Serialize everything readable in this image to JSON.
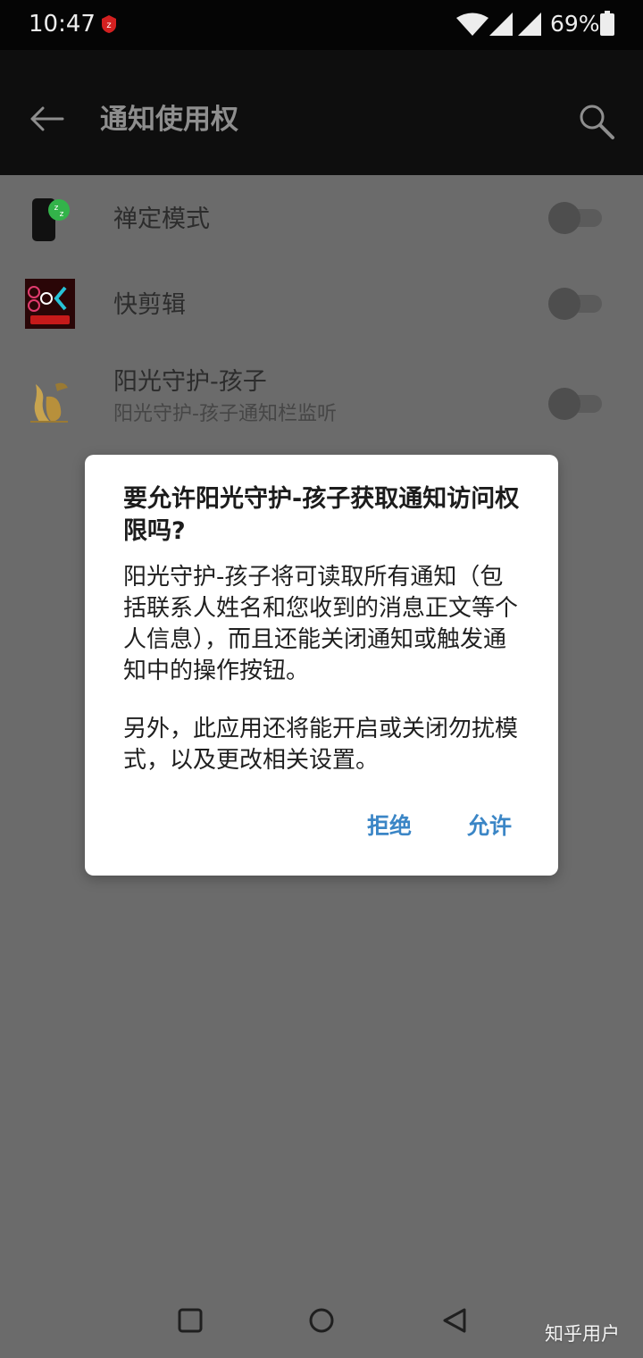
{
  "status_bar": {
    "time": "10:47",
    "battery_percent": "69%",
    "icons": [
      "zhihu-notification-icon",
      "wifi-icon",
      "signal-icon",
      "signal-icon",
      "battery-icon"
    ]
  },
  "toolbar": {
    "title": "通知使用权",
    "icons": [
      "back-arrow-icon",
      "search-icon"
    ]
  },
  "list": {
    "items": [
      {
        "title": "禅定模式",
        "subtitle": "",
        "enabled": false,
        "icon": "zen-mode-icon"
      },
      {
        "title": "快剪辑",
        "subtitle": "",
        "enabled": false,
        "icon": "kuaijianji-icon"
      },
      {
        "title": "阳光守护-孩子",
        "subtitle": "阳光守护-孩子通知栏监听",
        "enabled": false,
        "icon": "kangaroo-icon"
      }
    ]
  },
  "dialog": {
    "title": "要允许阳光守护-孩子获取通知访问权限吗?",
    "body": [
      "阳光守护-孩子将可读取所有通知（包括联系人姓名和您收到的消息正文等个人信息），而且还能关闭通知或触发通知中的操作按钮。",
      "另外，此应用还将能开启或关闭勿扰模式，以及更改相关设置。"
    ],
    "deny_label": "拒绝",
    "allow_label": "允许"
  },
  "nav_bar": {
    "icons": [
      "recents-icon",
      "home-icon",
      "back-icon"
    ]
  },
  "watermark": "知乎用户",
  "colors": {
    "scrim_background": "#6b6b6b",
    "status_bar": "#050505",
    "toolbar": "#0e0e0e",
    "dialog_background": "#ffffff",
    "button_text": "#3b86c6",
    "toggle_off": "#4e4e4e"
  }
}
